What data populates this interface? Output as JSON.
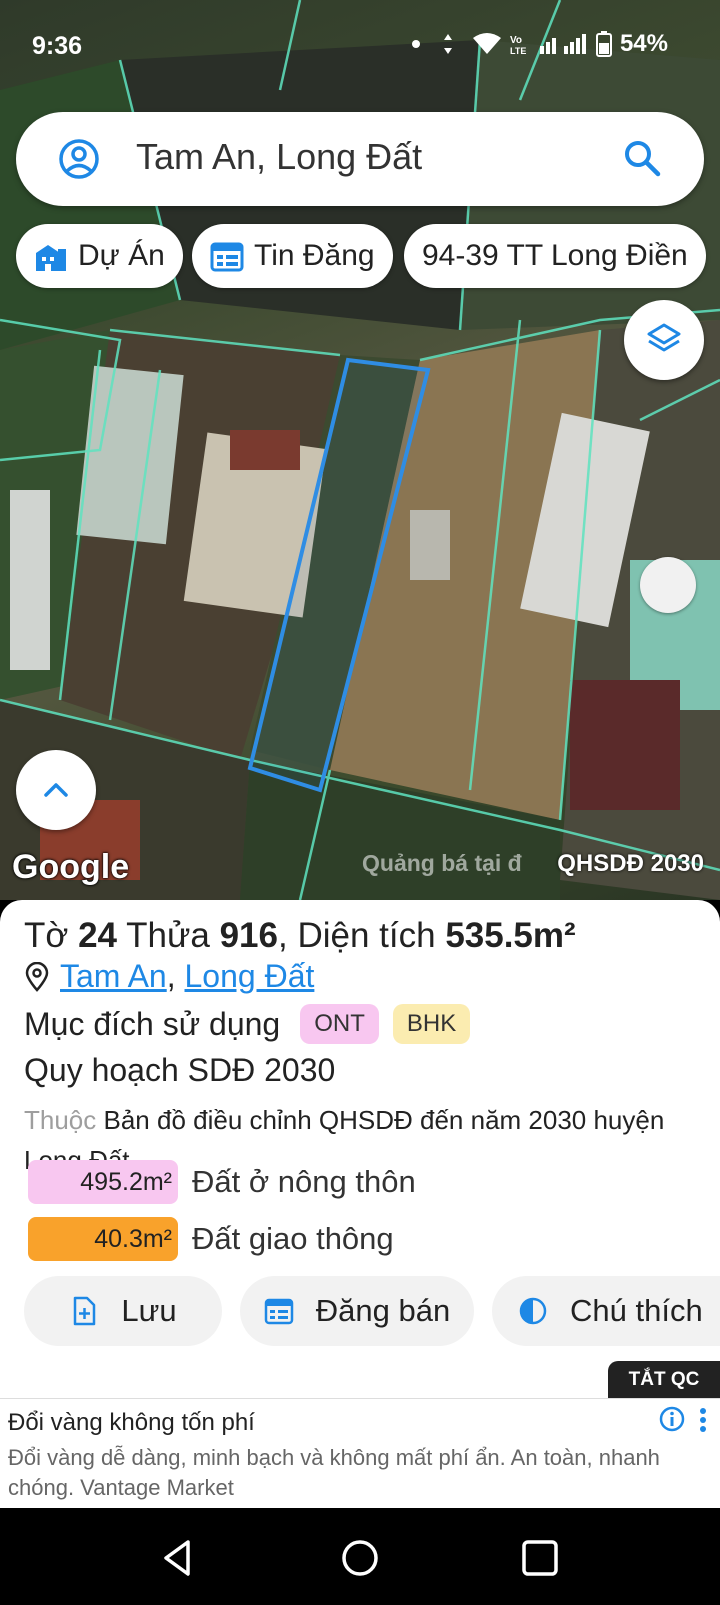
{
  "status_bar": {
    "time": "9:36",
    "battery": "54%"
  },
  "search": {
    "query": "Tam An, Long Đất"
  },
  "chips": [
    {
      "label": "Dự Án",
      "icon": "building-icon"
    },
    {
      "label": "Tin Đăng",
      "icon": "calendar-icon"
    },
    {
      "label": "94-39 TT Long Điền",
      "icon": ""
    }
  ],
  "map": {
    "attribution": "Google",
    "watermark": "Quảng bá tại đ",
    "layer_label": "QHSDĐ 2030"
  },
  "parcel": {
    "sheet_label": "Tờ",
    "sheet_number": "24",
    "plot_label": "Thửa",
    "plot_number": "916",
    "area_label": ", Diện tích",
    "area": "535.5m²",
    "ward": "Tam An",
    "district": "Long Đất",
    "purpose_label": "Mục đích sử dụng",
    "tags": [
      "ONT",
      "BHK"
    ],
    "plan_title": "Quy hoạch SDĐ 2030",
    "belongs_prefix": "Thuộc",
    "belongs_text": "Bản đồ điều chỉnh QHSDĐ đến năm 2030 huyện Long Đất",
    "land_use": [
      {
        "area": "495.2m²",
        "label": "Đất ở nông thôn",
        "color": "#f8c7f0"
      },
      {
        "area": "40.3m²",
        "label": "Đất giao thông",
        "color": "#f9a22b"
      }
    ]
  },
  "actions": {
    "save": "Lưu",
    "post": "Đăng bán",
    "legend": "Chú thích"
  },
  "ad_toggle": "TẮT QC",
  "ad": {
    "headline": "Đổi vàng không tốn phí",
    "body": "Đổi vàng dễ dàng, minh bạch và không mất phí ẩn. An toàn, nhanh chóng. Vantage Market"
  },
  "colors": {
    "accent": "#1e88e5",
    "parcel_outline": "#2f8de4",
    "cadastral_lines": "#5fe3c0"
  }
}
